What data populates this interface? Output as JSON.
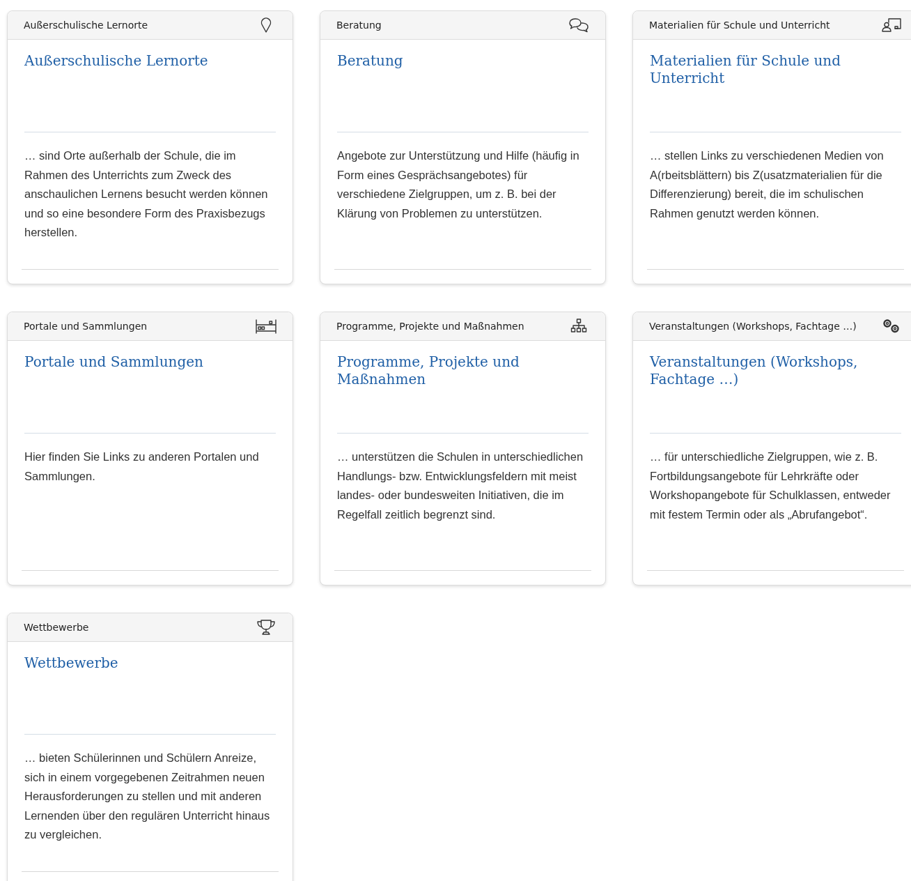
{
  "cards": [
    {
      "category": "Außerschulische Lernorte",
      "kind": "pin",
      "title": "Außerschulische Lernorte",
      "description": "… sind Orte außerhalb der Schule, die im Rahmen des Unterrichts zum Zweck des anschaulichen Lernens besucht werden können und so eine besondere Form des Praxisbezugs herstellen."
    },
    {
      "category": "Beratung",
      "kind": "chat",
      "title": "Beratung",
      "description": "Angebote zur Unterstützung und Hilfe (häufig in Form eines Gesprächsangebotes) für verschiedene Zielgruppen, um z. B. bei der Klärung von Problemen zu unterstützen."
    },
    {
      "category": "Materialien für Schule und Unterricht",
      "kind": "teacher",
      "title": "Materialien für Schule und Unterricht",
      "description": "… stellen Links zu verschiedenen Medien von A(rbeitsblättern) bis Z(usatzmaterialien für die Differenzierung) bereit, die im schulischen Rahmen genutzt werden können."
    },
    {
      "category": "Portale und Sammlungen",
      "kind": "shelf",
      "title": "Portale und Sammlungen",
      "description": "Hier finden Sie Links zu anderen Portalen und Sammlungen."
    },
    {
      "category": "Programme, Projekte und Maßnahmen",
      "kind": "hierarchy",
      "title": "Programme, Projekte und Maßnahmen",
      "description": "… unterstützen die Schulen in unterschiedlichen Handlungs- bzw. Entwicklungsfeldern mit meist landes- oder bundesweiten Initiativen, die im Regelfall zeitlich begrenzt sind."
    },
    {
      "category": "Veranstaltungen (Workshops, Fachtage …)",
      "kind": "gears",
      "title": "Veranstaltungen (Workshops, Fachtage …)",
      "description": "… für unterschiedliche Zielgruppen, wie z. B. Fortbildungsangebote für Lehrkräfte oder Workshopangebote für Schulklassen, entweder mit festem Termin oder als „Abrufangebot“."
    },
    {
      "category": "Wettbewerbe",
      "kind": "trophy",
      "title": "Wettbewerbe",
      "description": "… bieten Schülerinnen und Schülern Anreize, sich in einem vorgegebenen Zeitrahmen neuen Herausforderungen zu stellen und mit anderen Lernenden über den regulären Unterricht hinaus zu vergleichen."
    }
  ]
}
